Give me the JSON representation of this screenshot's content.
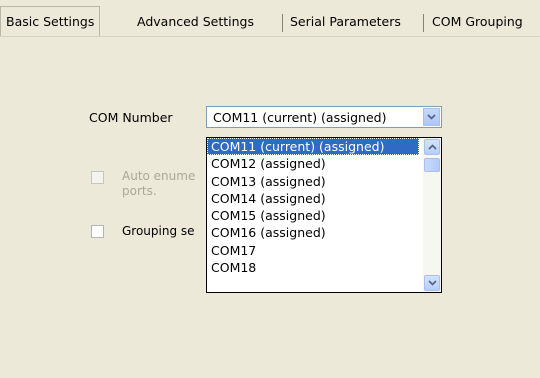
{
  "tabs": [
    {
      "label": "Basic Settings"
    },
    {
      "label": "Advanced Settings"
    },
    {
      "label": "Serial Parameters"
    },
    {
      "label": "COM Grouping"
    }
  ],
  "com_number": {
    "label": "COM Number",
    "selected": "COM11 (current) (assigned)",
    "options": [
      "COM11 (current) (assigned)",
      "COM12 (assigned)",
      "COM13 (assigned)",
      "COM14 (assigned)",
      "COM15 (assigned)",
      "COM16 (assigned)",
      "COM17",
      "COM18"
    ]
  },
  "checkboxes": {
    "auto_enum": {
      "label_line1": "Auto enume",
      "label_line2": "ports.",
      "checked": false,
      "disabled": true
    },
    "grouping": {
      "label": "Grouping se",
      "checked": false,
      "disabled": false
    }
  },
  "icons": {
    "combo_arrow": "chevron-down-icon",
    "scroll_up": "chevron-up-icon",
    "scroll_down": "chevron-down-icon"
  },
  "colors": {
    "window_bg": "#ece9d8",
    "selection": "#316ac5",
    "combo_border": "#7f9db9",
    "disabled_text": "#aca899"
  }
}
